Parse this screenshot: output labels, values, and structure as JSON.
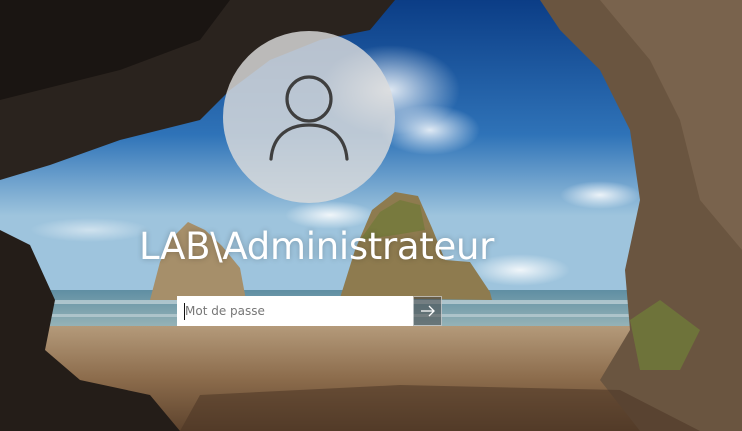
{
  "login": {
    "username": "LAB\\Administrateur",
    "password_placeholder": "Mot de passe",
    "password_value": ""
  },
  "icons": {
    "avatar": "user-silhouette-icon",
    "submit": "arrow-right-icon"
  },
  "colors": {
    "avatar_bg": "#dcdcdc",
    "text": "#ffffff",
    "input_bg": "#ffffff",
    "submit_bg": "#464646"
  }
}
